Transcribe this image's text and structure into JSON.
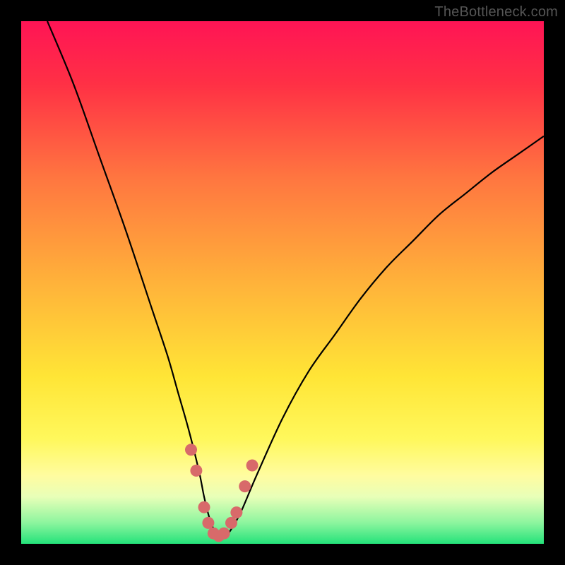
{
  "watermark": "TheBottleneck.com",
  "chart_data": {
    "type": "line",
    "title": "",
    "xlabel": "",
    "ylabel": "",
    "xlim": [
      0,
      100
    ],
    "ylim": [
      0,
      100
    ],
    "background_gradient": {
      "stops": [
        {
          "pos": 0.0,
          "color": "#ff1455"
        },
        {
          "pos": 0.12,
          "color": "#ff3045"
        },
        {
          "pos": 0.3,
          "color": "#ff7640"
        },
        {
          "pos": 0.5,
          "color": "#ffb23a"
        },
        {
          "pos": 0.68,
          "color": "#ffe536"
        },
        {
          "pos": 0.8,
          "color": "#fff85c"
        },
        {
          "pos": 0.87,
          "color": "#fffca0"
        },
        {
          "pos": 0.91,
          "color": "#e8ffb8"
        },
        {
          "pos": 0.96,
          "color": "#8cf59e"
        },
        {
          "pos": 1.0,
          "color": "#24e27a"
        }
      ]
    },
    "series": [
      {
        "name": "bottleneck-curve",
        "type": "line",
        "color": "#000000",
        "x": [
          5,
          10,
          15,
          20,
          25,
          28,
          30,
          32,
          34,
          35,
          36,
          37,
          38,
          39,
          40,
          42,
          45,
          50,
          55,
          60,
          65,
          70,
          75,
          80,
          85,
          90,
          95,
          100
        ],
        "y": [
          100,
          88,
          74,
          60,
          45,
          36,
          29,
          22,
          14,
          9,
          5,
          2.5,
          1.5,
          1.5,
          2.5,
          6,
          13,
          24,
          33,
          40,
          47,
          53,
          58,
          63,
          67,
          71,
          74.5,
          78
        ]
      },
      {
        "name": "marker-points",
        "type": "scatter",
        "color": "#d86a6a",
        "x": [
          32.5,
          33.5,
          35.0,
          35.8,
          36.8,
          37.8,
          38.8,
          40.2,
          41.2,
          42.8,
          44.2
        ],
        "y": [
          18.0,
          14.0,
          7.0,
          4.0,
          2.0,
          1.5,
          2.0,
          4.0,
          6.0,
          11.0,
          15.0
        ]
      }
    ]
  }
}
